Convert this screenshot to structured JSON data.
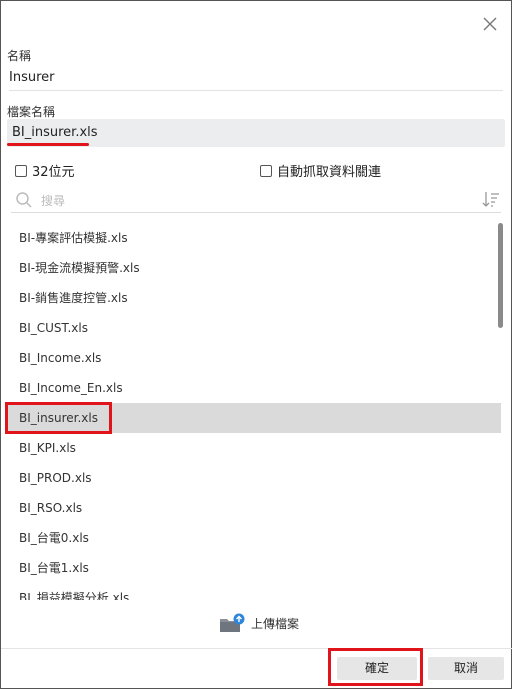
{
  "dialog": {
    "close_icon": "close-icon",
    "name_label": "名稱",
    "name_value": "Insurer",
    "file_name_label": "檔案名稱",
    "file_name_value": "BI_insurer.xls",
    "checkbox_32bit": "32位元",
    "checkbox_autofetch": "自動抓取資料關連",
    "search_placeholder": "搜尋",
    "files": [
      "BI-專案評估模擬.xls",
      "BI-現金流模擬預警.xls",
      "BI-銷售進度控管.xls",
      "BI_CUST.xls",
      "BI_Income.xls",
      "BI_Income_En.xls",
      "BI_insurer.xls",
      "BI_KPI.xls",
      "BI_PROD.xls",
      "BI_RSO.xls",
      "BI_台電0.xls",
      "BI_台電1.xls",
      "BI_損益模擬分析.xls"
    ],
    "selected_file": "BI_insurer.xls",
    "upload_label": "上傳檔案",
    "ok_label": "確定",
    "cancel_label": "取消"
  },
  "colors": {
    "highlight": "#e0151b",
    "selected_row": "#dadada",
    "input_bg": "#ecedef"
  }
}
